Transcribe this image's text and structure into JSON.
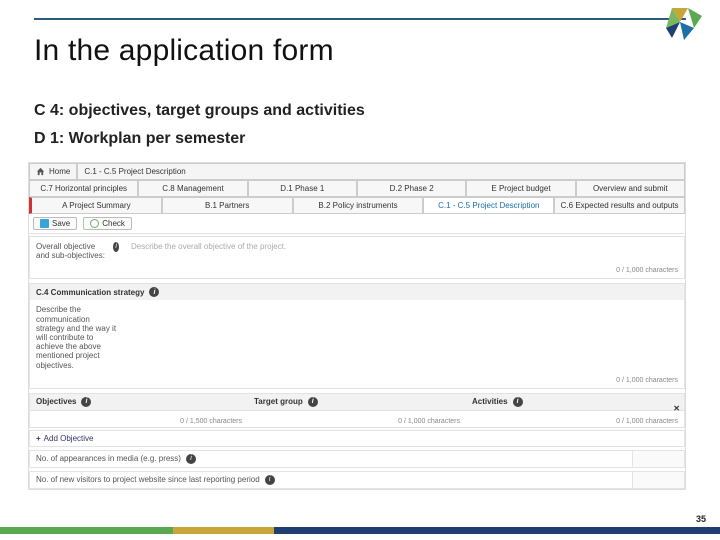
{
  "slide": {
    "title": "In the application form",
    "sub1": "C 4: objectives, target groups and activities",
    "sub2": "D 1: Workplan per semester",
    "page_number": "35"
  },
  "app": {
    "crumb_home_label": "Home",
    "crumb_current": "C.1 - C.5 Project Description",
    "tabs_row1": [
      "C.7 Horizontal principles",
      "C.8 Management",
      "D.1 Phase 1",
      "D.2 Phase 2",
      "E Project budget",
      "Overview and submit"
    ],
    "tabs_row2": [
      "A Project Summary",
      "B.1 Partners",
      "B.2 Policy instruments",
      "C.1 - C.5 Project Description",
      "C.6 Expected results and outputs"
    ],
    "active_tab": "C.1 - C.5 Project Description",
    "save_label": "Save",
    "check_label": "Check",
    "overall_obj": {
      "left_label": "Overall objective and sub-objectives:",
      "placeholder": "Describe the overall objective of the project.",
      "char_count": "0 / 1,000 characters"
    },
    "c4": {
      "header": "C.4 Communication strategy",
      "left_label": "Describe the communication strategy and the way it will contribute to achieve the above mentioned project objectives.",
      "char_count": "0 / 1,000 characters"
    },
    "table": {
      "col1": "Objectives",
      "col2": "Target group",
      "col3": "Activities",
      "cc1": "0 / 1,500 characters",
      "cc2": "0 / 1,000 characters",
      "cc3": "0 / 1,000 characters",
      "add_label": "Add Objective"
    },
    "stats": {
      "media_label": "No. of appearances in media (e.g. press)",
      "visitors_label": "No. of new visitors to project website since last reporting period"
    }
  }
}
